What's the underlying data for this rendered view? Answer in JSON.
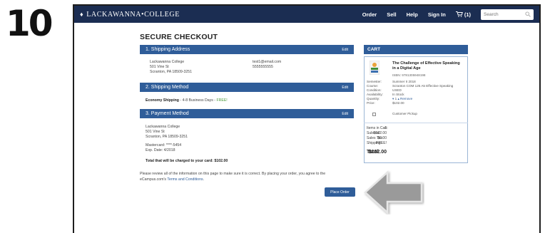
{
  "step_number": "10",
  "header": {
    "logo": "LACKAWANNA•COLLEGE",
    "nav": [
      "Order",
      "Sell",
      "Help",
      "Sign In"
    ],
    "cart_count": "(1)",
    "search_placeholder": "Search"
  },
  "page_title": "SECURE CHECKOUT",
  "shipping_address": {
    "header": "1. Shipping Address",
    "edit": "Edit",
    "lines": [
      "Lackawanna College",
      "501 Vine St",
      "Scranton, PA 18509-3251"
    ],
    "email": "test1@email.com",
    "phone": "5555555555"
  },
  "shipping_method": {
    "header": "2. Shipping Method",
    "edit": "Edit",
    "name": "Economy Shipping",
    "detail": " - 4-8 Business Days - ",
    "free": "FREE!"
  },
  "payment_method": {
    "header": "3. Payment Method",
    "edit": "Edit",
    "lines": [
      "Lackawanna College",
      "501 Vine St",
      "Scranton, PA 18509-3251"
    ],
    "card": "Mastercard: ****-5454",
    "exp": "Exp. Date: 4/2018",
    "total_note": "Total that will be charged to your card: $102.00"
  },
  "review_note": "Please review all of the information on this page to make sure it is correct. By placing your order, you agree to the",
  "review_note2": "eCampus.com's ",
  "terms_link": "Terms and Conditions",
  "place_order": "Place Order",
  "cart": {
    "header": "CART",
    "book_title": "The Challenge of Effective Speaking in a Digital Age",
    "isbn": "ISBN: 9781305948198",
    "meta": [
      {
        "label": "Semester:",
        "value": "Summer II 2018"
      },
      {
        "label": "Course:",
        "value": "Scranton COM 125 A5 Effective Speaking"
      },
      {
        "label": "Condition:",
        "value": "USED"
      },
      {
        "label": "Availability:",
        "value": "In Stock"
      },
      {
        "label": "Quantity:",
        "value": "1"
      },
      {
        "label": "Price:",
        "value": "$102.00"
      }
    ],
    "remove": "Remove",
    "pickup": "Customer Pickup",
    "summary": [
      {
        "label": "Items in Cart:",
        "value": "1"
      },
      {
        "label": "Subtotal:",
        "value": "$102.00"
      },
      {
        "label": "Sales Tax:",
        "value": "$0.00"
      },
      {
        "label": "Shipping:",
        "value": "FREE!"
      }
    ],
    "total_label": "Total:",
    "total_value": "$102.00"
  },
  "colors": {
    "navbar": "#1b2d52",
    "section": "#2f5d99",
    "free": "#4a9a3a"
  }
}
